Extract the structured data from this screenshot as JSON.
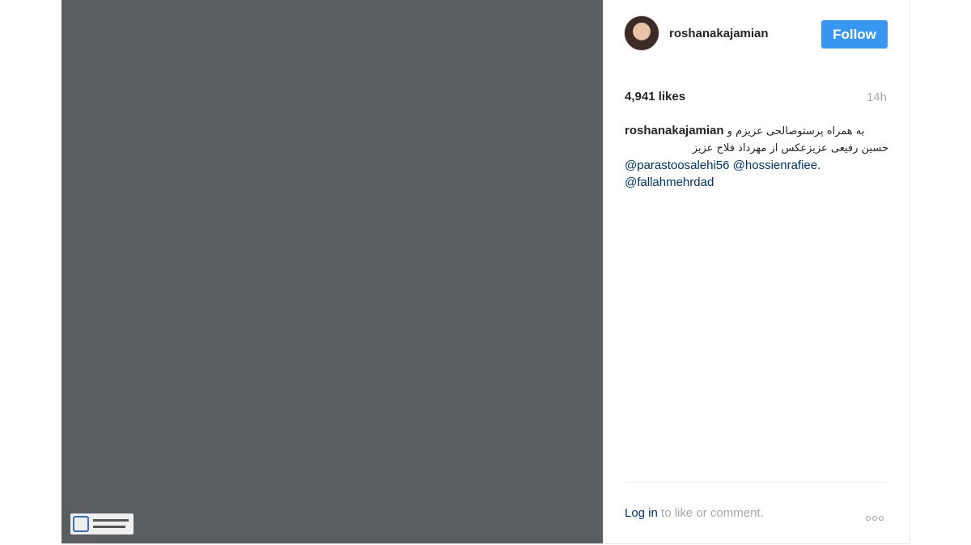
{
  "post": {
    "photo_alt": "",
    "watermark_logo": "photographer-logo",
    "username": "roshanakajamian",
    "follow_label": "Follow",
    "likes": "4,941 likes",
    "time": "14h",
    "caption": {
      "user": "roshanakajamian",
      "text_rtl_1": "به همراه پرستوصالحی عزیزم و",
      "text_rtl_2": "حسین رفیعی عزیزعکس از مهرداد فلاح عزیز",
      "mention_1": "@parastoosalehi56",
      "mention_2": "@hossienrafiee.",
      "mention_3": "@fallahmehrdad"
    },
    "login_label": "Log in",
    "login_suffix": " to like or comment.",
    "more_icon": "ellipsis-icon"
  },
  "colors": {
    "follow_bg": "#3897f0",
    "link": "#003569",
    "muted": "#a5a7aa"
  }
}
